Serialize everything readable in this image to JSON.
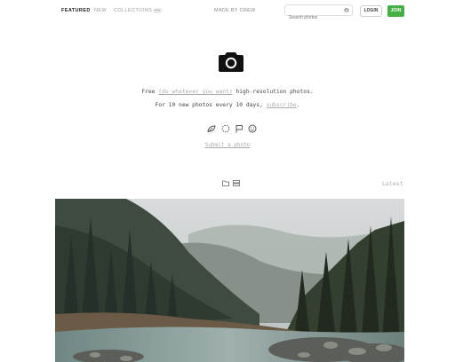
{
  "nav": {
    "featured": "FEATURED",
    "new": "NEW",
    "collections": "COLLECTIONS",
    "badge": "•••",
    "made_by": "MADE BY CREW",
    "search_placeholder": "Search photos",
    "login": "LOGIN",
    "join": "JOIN"
  },
  "hero": {
    "line1_before": "Free ",
    "line1_link": "(do whatever you want)",
    "line1_after": " high-resolution photos.",
    "line2_before": "For 10 new photos every 10 days, ",
    "line2_link": "subscribe",
    "line2_after": ".",
    "icons": [
      "leaf-icon",
      "loading-circle-icon",
      "flag-icon",
      "smiley-icon"
    ],
    "submit": "Submit a photo"
  },
  "view": {
    "icons": [
      "folder-icon",
      "grid-icon"
    ],
    "sort": "Latest"
  },
  "colors": {
    "accent": "#46b046",
    "text": "#333333",
    "muted": "#aaaaaa"
  }
}
